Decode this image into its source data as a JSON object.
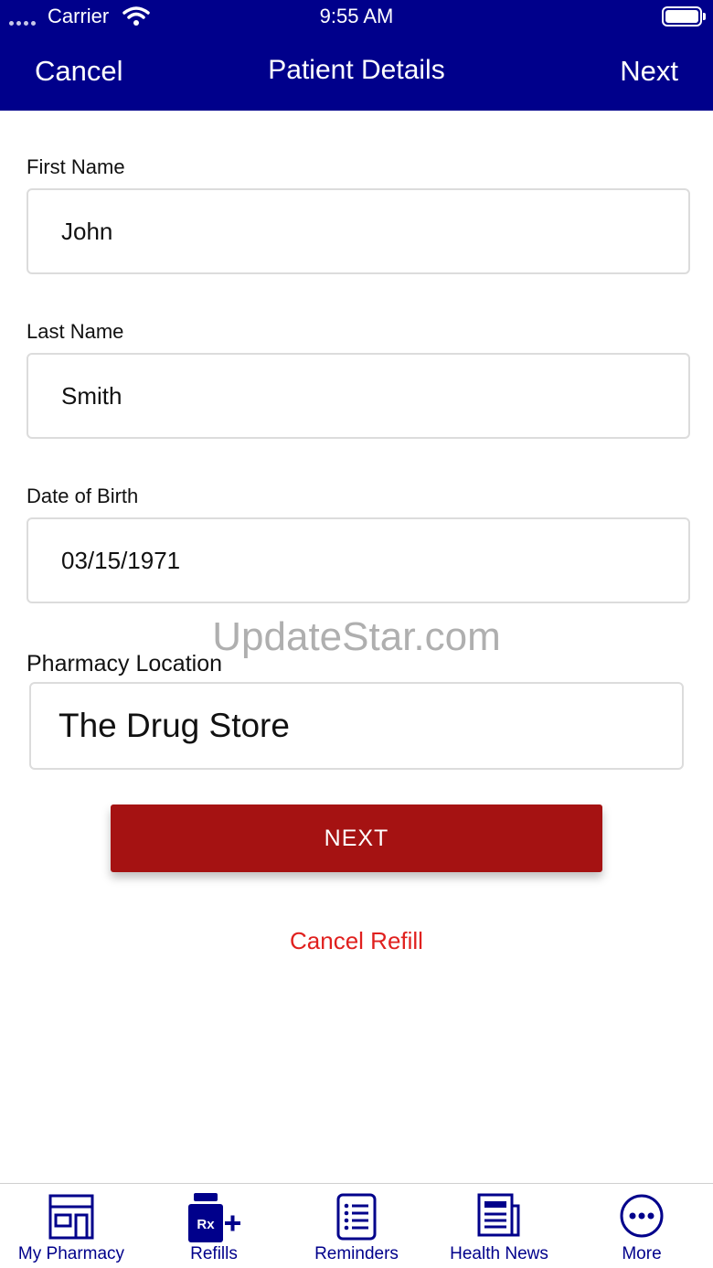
{
  "status_bar": {
    "carrier": "Carrier",
    "time": "9:55 AM"
  },
  "nav": {
    "cancel_label": "Cancel",
    "title": "Patient Details",
    "next_label": "Next"
  },
  "form": {
    "first_name": {
      "label": "First Name",
      "value": "John"
    },
    "last_name": {
      "label": "Last Name",
      "value": "Smith"
    },
    "dob": {
      "label": "Date of Birth",
      "value": "03/15/1971"
    },
    "pharmacy": {
      "label": "Pharmacy Location",
      "value": "The Drug Store"
    }
  },
  "watermark": "UpdateStar.com",
  "actions": {
    "next_label": "NEXT",
    "cancel_refill_label": "Cancel Refill"
  },
  "tabbar": {
    "items": [
      {
        "label": "My Pharmacy",
        "icon": "store-icon"
      },
      {
        "label": "Refills",
        "icon": "rx-bottle-icon",
        "badge": "Rx"
      },
      {
        "label": "Reminders",
        "icon": "list-icon"
      },
      {
        "label": "Health News",
        "icon": "newspaper-icon"
      },
      {
        "label": "More",
        "icon": "more-dots-icon"
      }
    ]
  },
  "colors": {
    "brand": "#00008b",
    "primary_button": "#a51212",
    "cancel_link": "#e0201e"
  }
}
